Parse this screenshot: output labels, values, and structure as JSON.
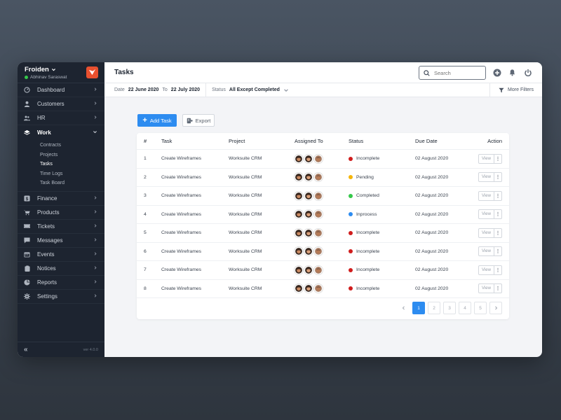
{
  "colors": {
    "accent": "#2d8cf0",
    "sidebar_bg": "#1d2430",
    "brand_logo": "#e8502f",
    "online": "#35c84a",
    "status_incomplete": "#d01d1d",
    "status_pending": "#f5b50a",
    "status_completed": "#35c84a",
    "status_inprocess": "#2d8cf0"
  },
  "brand": {
    "name": "Froiden",
    "user": "Abhinav Saraswat",
    "version": "ver 4.0.0"
  },
  "sidebar": {
    "items": [
      {
        "label": "Dashboard",
        "icon": "dashboard-icon"
      },
      {
        "label": "Customers",
        "icon": "user-icon"
      },
      {
        "label": "HR",
        "icon": "users-icon"
      },
      {
        "label": "Work",
        "icon": "layers-icon"
      },
      {
        "label": "Finance",
        "icon": "dollar-icon"
      },
      {
        "label": "Products",
        "icon": "cart-icon"
      },
      {
        "label": "Tickets",
        "icon": "ticket-icon"
      },
      {
        "label": "Messages",
        "icon": "message-icon"
      },
      {
        "label": "Events",
        "icon": "calendar-icon"
      },
      {
        "label": "Notices",
        "icon": "clipboard-icon"
      },
      {
        "label": "Reports",
        "icon": "pie-chart-icon"
      },
      {
        "label": "Settings",
        "icon": "gear-icon"
      }
    ],
    "work_sub": [
      "Contracts",
      "Projects",
      "Tasks",
      "Time Logs",
      "Task Board"
    ]
  },
  "header": {
    "title": "Tasks",
    "search_placeholder": "Search"
  },
  "filters": {
    "date_label": "Date",
    "date_from": "22 June 2020",
    "to_label": "To",
    "date_to": "22 July 2020",
    "status_label": "Status",
    "status_value": "All Except Completed",
    "more_filters": "More Filters"
  },
  "actions": {
    "add_task": "Add Task",
    "export": "Export"
  },
  "table": {
    "columns": [
      "#",
      "Task",
      "Project",
      "Assigned To",
      "Status",
      "Due Date",
      "Action"
    ],
    "rows": [
      {
        "num": "1",
        "task": "Create Wireframes",
        "project": "Worksuite CRM",
        "status": "Incomplete",
        "status_color": "#d01d1d",
        "due": "02 August 2020"
      },
      {
        "num": "2",
        "task": "Create Wireframes",
        "project": "Worksuite CRM",
        "status": "Pending",
        "status_color": "#f5b50a",
        "due": "02 August 2020"
      },
      {
        "num": "3",
        "task": "Create Wireframes",
        "project": "Worksuite CRM",
        "status": "Completed",
        "status_color": "#35c84a",
        "due": "02 August 2020"
      },
      {
        "num": "4",
        "task": "Create Wireframes",
        "project": "Worksuite CRM",
        "status": "Inprocess",
        "status_color": "#2d8cf0",
        "due": "02 August 2020"
      },
      {
        "num": "5",
        "task": "Create Wireframes",
        "project": "Worksuite CRM",
        "status": "Incomplete",
        "status_color": "#d01d1d",
        "due": "02 August 2020"
      },
      {
        "num": "6",
        "task": "Create Wireframes",
        "project": "Worksuite CRM",
        "status": "Incomplete",
        "status_color": "#d01d1d",
        "due": "02 August 2020"
      },
      {
        "num": "7",
        "task": "Create Wireframes",
        "project": "Worksuite CRM",
        "status": "Incomplete",
        "status_color": "#d01d1d",
        "due": "02 August 2020"
      },
      {
        "num": "8",
        "task": "Create Wireframes",
        "project": "Worksuite CRM",
        "status": "Incomplete",
        "status_color": "#d01d1d",
        "due": "02 August 2020"
      }
    ],
    "view_label": "View"
  },
  "pagination": {
    "pages": [
      "1",
      "2",
      "3",
      "4",
      "5"
    ],
    "current": "1"
  }
}
